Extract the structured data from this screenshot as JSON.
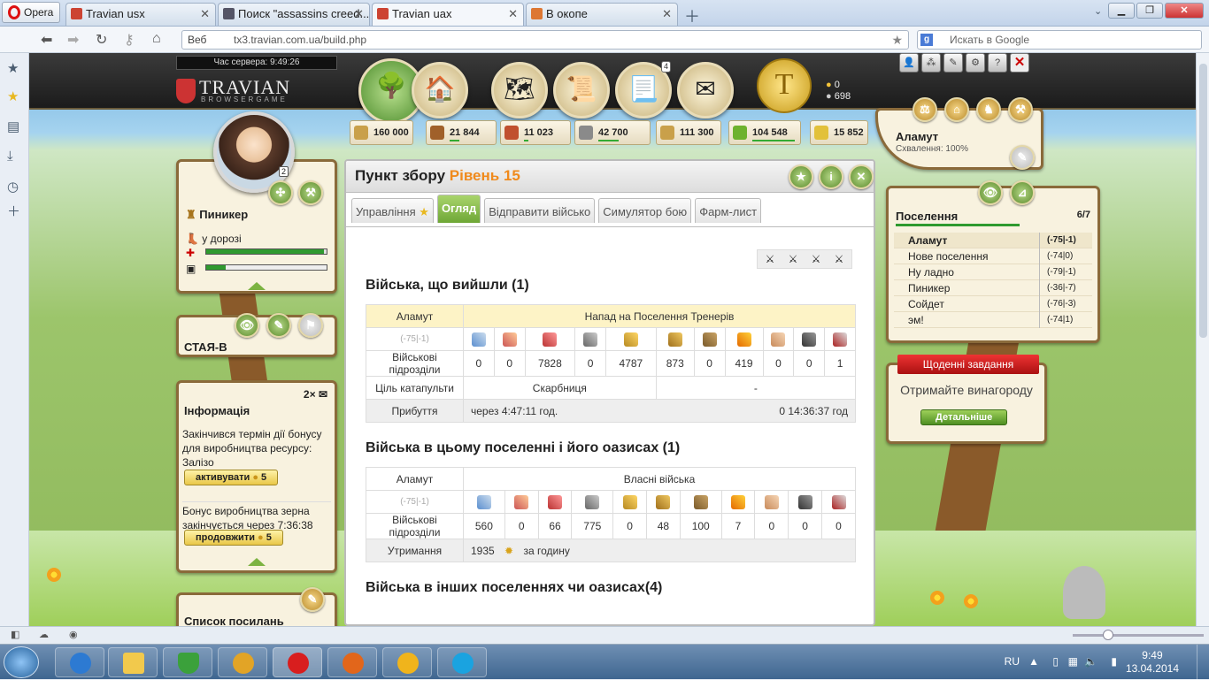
{
  "browser": {
    "menu_label": "Opera",
    "tabs": [
      {
        "title": "Travian usx",
        "active": false
      },
      {
        "title": "Поиск \"assassins creed...",
        "active": false
      },
      {
        "title": "Travian uax",
        "active": true
      },
      {
        "title": "В окопе",
        "active": false
      }
    ],
    "secure_label": "Веб",
    "url": "tx3.travian.com.ua/build.php",
    "search_placeholder": "Искать в Google"
  },
  "taskbar": {
    "lang": "RU",
    "time": "9:49",
    "date": "13.04.2014"
  },
  "game": {
    "server_time": "Час сервера:  9:49:26",
    "logo": "TRAVIAN",
    "logo_sub": "BROWSERGAME",
    "reports_badge": "4",
    "gold": {
      "gold": "0",
      "silver": "698"
    },
    "resources": {
      "warehouse": "160 000",
      "wood": "21 844",
      "clay": "11 023",
      "iron": "42 700",
      "granary": "111 300",
      "crop": "104 548",
      "crop_consumption": "15 852"
    },
    "hero": {
      "name": "Пиникер",
      "status": "у дорозі",
      "adventures": "2"
    },
    "alliance": {
      "name": "СТАЯ-В"
    },
    "info": {
      "title": "Інформація",
      "count": "2×",
      "msg1": "Закінчився термін дії бонусу для виробництва ресурсу: Залізо",
      "btn1": "активувати",
      "btn1_cost": "5",
      "msg2": "Бонус виробництва зерна закінчується через 7:36:38",
      "btn2": "продовжити",
      "btn2_cost": "5"
    },
    "links_title": "Список посилань",
    "village": {
      "name": "Аламут",
      "loyalty": "Схвалення: 100%"
    },
    "villages": {
      "title": "Поселення",
      "count": "6/7",
      "list": [
        {
          "name": "Аламут",
          "coords": "(-75|-1)",
          "selected": true
        },
        {
          "name": "Нове поселення",
          "coords": "(-74|0)",
          "selected": false
        },
        {
          "name": "Ну ладно",
          "coords": "(-79|-1)",
          "selected": false
        },
        {
          "name": "Пиникер",
          "coords": "(-36|-7)",
          "selected": false
        },
        {
          "name": "Сойдет",
          "coords": "(-76|-3)",
          "selected": false
        },
        {
          "name": "эм!",
          "coords": "(-74|1)",
          "selected": false
        }
      ]
    },
    "daily": {
      "title": "Щоденні завдання",
      "text": "Отримайте винагороду",
      "button": "Детальніше"
    },
    "building": {
      "name": "Пункт збору",
      "level": "Рівень 15",
      "tabs": [
        "Управління",
        "Огляд",
        "Відправити військо",
        "Симулятор бою",
        "Фарм-лист"
      ],
      "active_tab": "Огляд"
    },
    "outgoing": {
      "heading": "Війська, що вийшли (1)",
      "village": "Аламут",
      "target": "Напад на Поселення Тренерів",
      "coords": "(-75|-1)",
      "units_label": "Військові підрозділи",
      "units": [
        "0",
        "0",
        "7828",
        "0",
        "4787",
        "873",
        "0",
        "419",
        "0",
        "0",
        "1"
      ],
      "catapult_label": "Ціль катапульти",
      "catapult_target": "Скарбниця",
      "catapult_target2": "-",
      "arrival_label": "Прибуття",
      "arrival_in": "через 4:47:11 год.",
      "arrival_at": "0 14:36:37 год"
    },
    "home": {
      "heading": "Війська в цьому поселенні і його оазисах (1)",
      "village": "Аламут",
      "title": "Власні війська",
      "coords": "(-75|-1)",
      "units_label": "Військові підрозділи",
      "units": [
        "560",
        "0",
        "66",
        "775",
        "0",
        "48",
        "100",
        "7",
        "0",
        "0",
        "0"
      ],
      "upkeep_label": "Утримання",
      "upkeep_value": "1935",
      "upkeep_unit": "за годину"
    },
    "others_heading": "Війська в інших поселеннях чи оазисах(4)"
  }
}
